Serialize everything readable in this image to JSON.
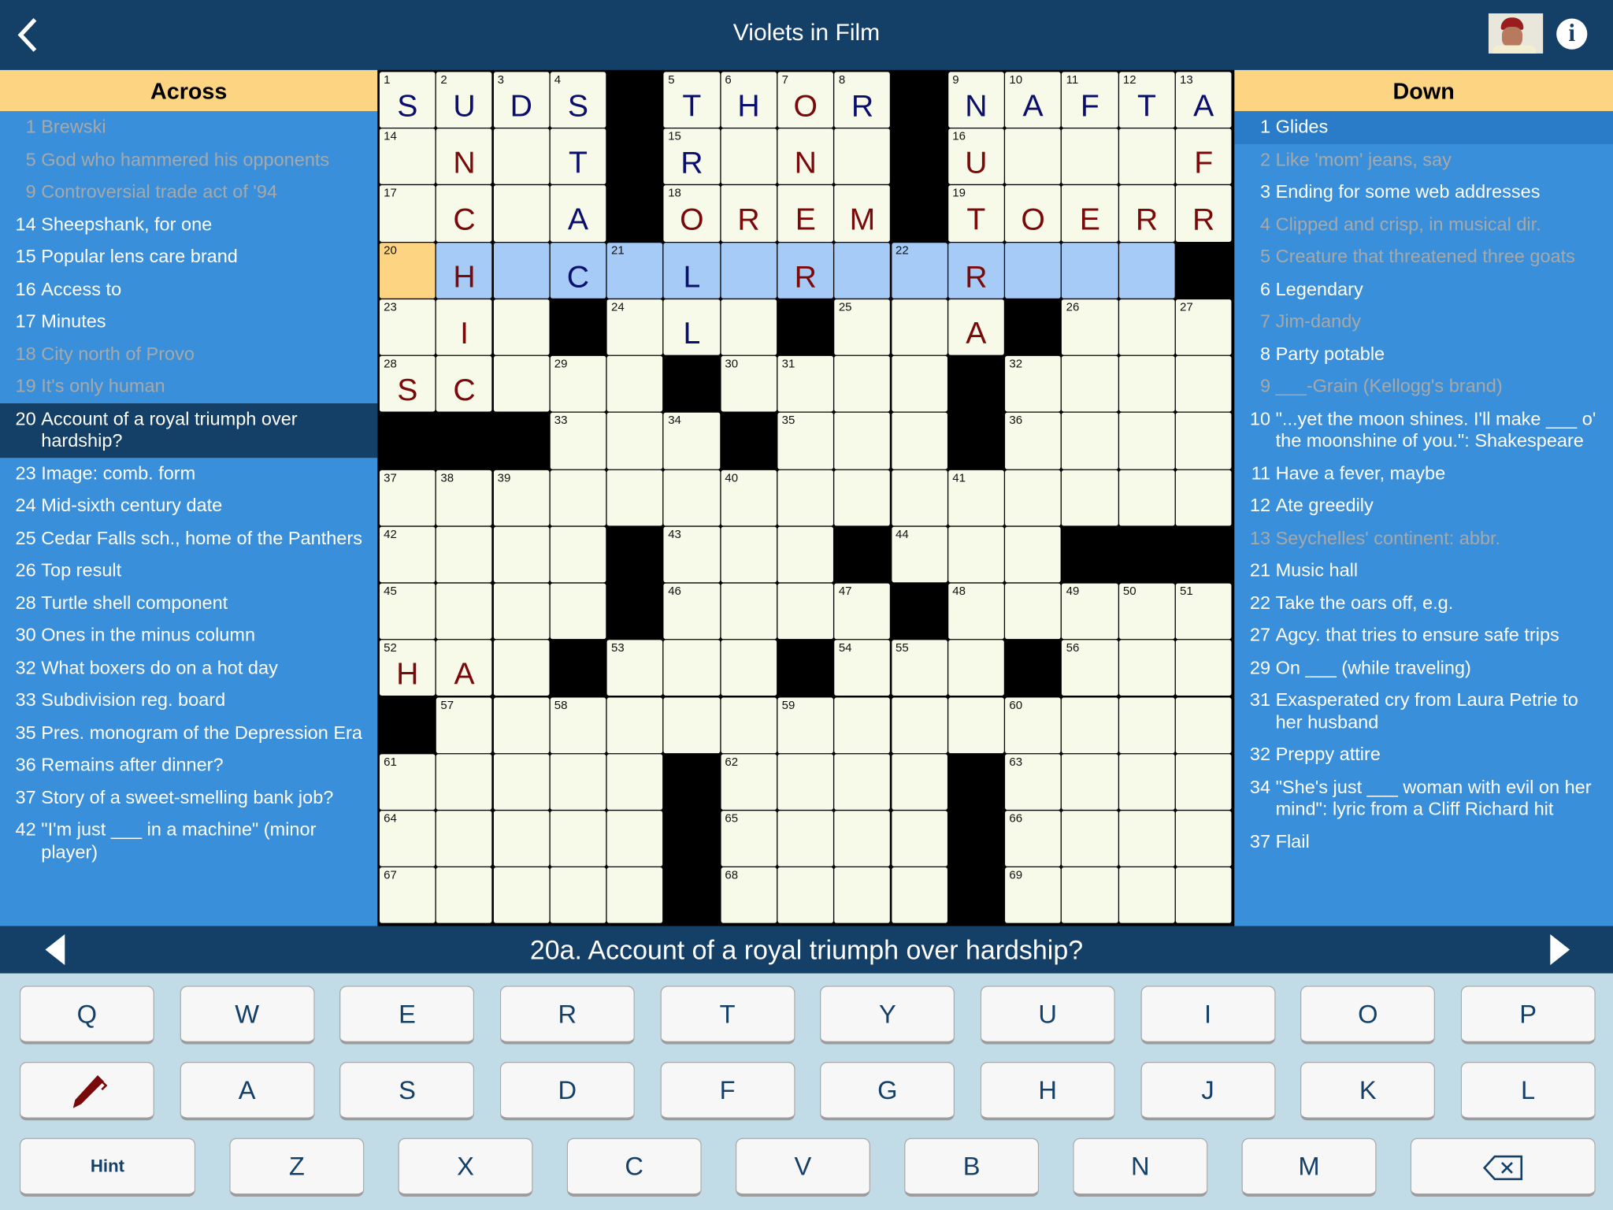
{
  "header": {
    "title": "Violets in Film",
    "back_icon": "chevron-left-icon",
    "info_icon": "info-icon"
  },
  "across": {
    "heading": "Across",
    "clues": [
      {
        "num": "1",
        "text": "Brewski",
        "done": true
      },
      {
        "num": "5",
        "text": "God who hammered his opponents",
        "done": true
      },
      {
        "num": "9",
        "text": "Controversial trade act of '94",
        "done": true
      },
      {
        "num": "14",
        "text": "Sheepshank, for one",
        "done": false
      },
      {
        "num": "15",
        "text": "Popular lens care brand",
        "done": false
      },
      {
        "num": "16",
        "text": "Access to",
        "done": false
      },
      {
        "num": "17",
        "text": "Minutes",
        "done": false
      },
      {
        "num": "18",
        "text": "City north of Provo",
        "done": true
      },
      {
        "num": "19",
        "text": "It's only human",
        "done": true
      },
      {
        "num": "20",
        "text": "Account of a royal triumph over hardship?",
        "done": false,
        "selected": true
      },
      {
        "num": "23",
        "text": "Image: comb. form",
        "done": false
      },
      {
        "num": "24",
        "text": "Mid-sixth century date",
        "done": false
      },
      {
        "num": "25",
        "text": "Cedar Falls sch., home of the Panthers",
        "done": false
      },
      {
        "num": "26",
        "text": "Top result",
        "done": false
      },
      {
        "num": "28",
        "text": "Turtle shell component",
        "done": false
      },
      {
        "num": "30",
        "text": "Ones in the minus column",
        "done": false
      },
      {
        "num": "32",
        "text": "What boxers do on a hot day",
        "done": false
      },
      {
        "num": "33",
        "text": "Subdivision reg. board",
        "done": false
      },
      {
        "num": "35",
        "text": "Pres. monogram of the Depression Era",
        "done": false
      },
      {
        "num": "36",
        "text": "Remains after dinner?",
        "done": false
      },
      {
        "num": "37",
        "text": "Story of a sweet-smelling bank job?",
        "done": false
      },
      {
        "num": "42",
        "text": "\"I'm just ___ in a machine\" (minor player)",
        "done": false
      }
    ]
  },
  "down": {
    "heading": "Down",
    "clues": [
      {
        "num": "1",
        "text": "Glides",
        "done": false,
        "selected": true
      },
      {
        "num": "2",
        "text": "Like 'mom' jeans, say",
        "done": true
      },
      {
        "num": "3",
        "text": "Ending for some web addresses",
        "done": false
      },
      {
        "num": "4",
        "text": "Clipped and crisp, in musical dir.",
        "done": true
      },
      {
        "num": "5",
        "text": "Creature that threatened three goats",
        "done": true
      },
      {
        "num": "6",
        "text": "Legendary",
        "done": false
      },
      {
        "num": "7",
        "text": "Jim-dandy",
        "done": true
      },
      {
        "num": "8",
        "text": "Party potable",
        "done": false
      },
      {
        "num": "9",
        "text": "___-Grain (Kellogg's brand)",
        "done": true
      },
      {
        "num": "10",
        "text": "\"...yet the moon shines. I'll make ___ o' the moonshine of you.\": Shakespeare",
        "done": false
      },
      {
        "num": "11",
        "text": "Have a fever, maybe",
        "done": false
      },
      {
        "num": "12",
        "text": "Ate greedily",
        "done": false
      },
      {
        "num": "13",
        "text": "Seychelles' continent: abbr.",
        "done": true
      },
      {
        "num": "21",
        "text": "Music hall",
        "done": false
      },
      {
        "num": "22",
        "text": "Take the oars off, e.g.",
        "done": false
      },
      {
        "num": "27",
        "text": "Agcy. that tries to ensure safe trips",
        "done": false
      },
      {
        "num": "29",
        "text": "On ___ (while traveling)",
        "done": false
      },
      {
        "num": "31",
        "text": "Exasperated cry from Laura Petrie to her husband",
        "done": false
      },
      {
        "num": "32",
        "text": "Preppy attire",
        "done": false
      },
      {
        "num": "34",
        "text": "\"She's just ___ woman with evil on her mind\": lyric from a Cliff Richard hit",
        "done": false
      },
      {
        "num": "37",
        "text": "Flail",
        "done": false
      }
    ]
  },
  "grid": {
    "rows": [
      "SUDS#THOR#NAFTA",
      ".N.T#R.N.#U...F",
      ".C.A#OREM#TOERR",
      ".H.C.L.R..R...#",
      ".I.#.L.#..A#...",
      "SC...#....#....",
      "###...#...#....",
      "...............",
      "....#...#...###",
      "....#....#.....",
      "HA.#...#...#...",
      "#..............",
      ".....#....#....",
      ".....#....#....",
      ".....#....#...."
    ],
    "ink": [
      "bbbb.bbrb.bbbbb",
      ".r.b.b.r..r...r",
      ".r.b.rrrr.rrrrr",
      ".r.b.b.r..r....",
      ".r...b....r....",
      "rr.............",
      "...............",
      "...............",
      "...............",
      "...............",
      "rr.............",
      "...............",
      "...............",
      "...............",
      "..............."
    ],
    "cursor": {
      "row": 3,
      "col": 0
    },
    "highlight": {
      "row": 3,
      "from": 0,
      "to": 13
    },
    "colors": {
      "blue_ink": "#0A0F6E",
      "red_ink": "#7A0A0A",
      "highlight": "#A6CBF6",
      "cursor": "#FDD482"
    }
  },
  "clue_bar": {
    "text": "20a. Account of a royal triumph over hardship?",
    "prev_icon": "triangle-left-icon",
    "next_icon": "triangle-right-icon"
  },
  "keyboard": {
    "row1": [
      "Q",
      "W",
      "E",
      "R",
      "T",
      "Y",
      "U",
      "I",
      "O",
      "P"
    ],
    "row2": [
      "A",
      "S",
      "D",
      "F",
      "G",
      "H",
      "J",
      "K",
      "L"
    ],
    "row3": [
      "Z",
      "X",
      "C",
      "V",
      "B",
      "N",
      "M"
    ],
    "hint_label": "Hint",
    "pen_icon": "pen-icon",
    "backspace_icon": "backspace-icon"
  }
}
